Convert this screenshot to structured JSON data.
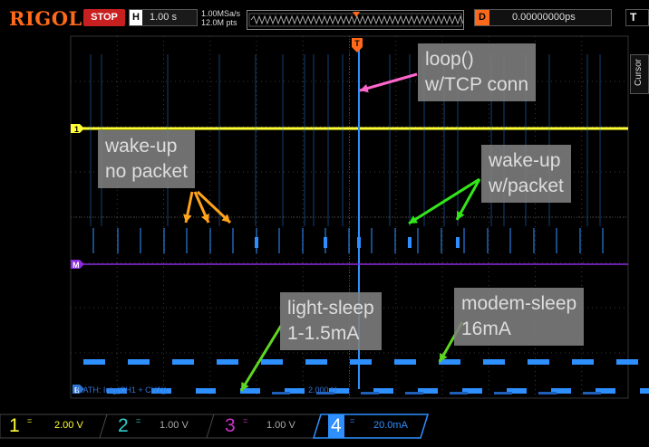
{
  "header": {
    "brand": "RIGOL",
    "run_state": "STOP",
    "horizontal_key": "H",
    "timebase": "1.00 s",
    "sample_rate": "1.00MSa/s",
    "memory_depth": "12.0M pts",
    "trigger_marker": "T",
    "delay_key": "D",
    "delay_value": "0.00000000ps",
    "trigger_key": "T"
  },
  "side_tab": {
    "cursor_label": "Cursor"
  },
  "markers": {
    "ch1_marker": "1",
    "math_marker": "M",
    "math_channel_marker": "B"
  },
  "math": {
    "label": "MATH: Intg(CH1 + CH1))",
    "scale": "2.000 U"
  },
  "annotations": [
    {
      "text": "loop()\nw/TCP conn",
      "color": "#ff66cc"
    },
    {
      "text": "wake-up\nno packet",
      "color": "#ffa31a"
    },
    {
      "text": "wake-up\nw/packet",
      "color": "#33e61a"
    },
    {
      "text": "light-sleep\n1-1.5mA",
      "color": "#5fd61f"
    },
    {
      "text": "modem-sleep\n16mA",
      "color": "#5fd61f"
    }
  ],
  "channels": [
    {
      "number": "1",
      "coupling": "=",
      "scale": "2.00 V",
      "color": "#ffff33",
      "active": false
    },
    {
      "number": "2",
      "coupling": "=",
      "scale": "1.00 V",
      "color": "#33cccc",
      "active": false
    },
    {
      "number": "3",
      "coupling": "=",
      "scale": "1.00 V",
      "color": "#cc33cc",
      "active": false
    },
    {
      "number": "4",
      "coupling": "=",
      "scale": "20.0mA",
      "color": "#2e8fff",
      "active": true
    }
  ],
  "colors": {
    "accent": "#ff6a1a",
    "stop": "#c82020",
    "ch1": "#ffff33",
    "ch4": "#2e8fff",
    "math": "#8a2be2"
  }
}
